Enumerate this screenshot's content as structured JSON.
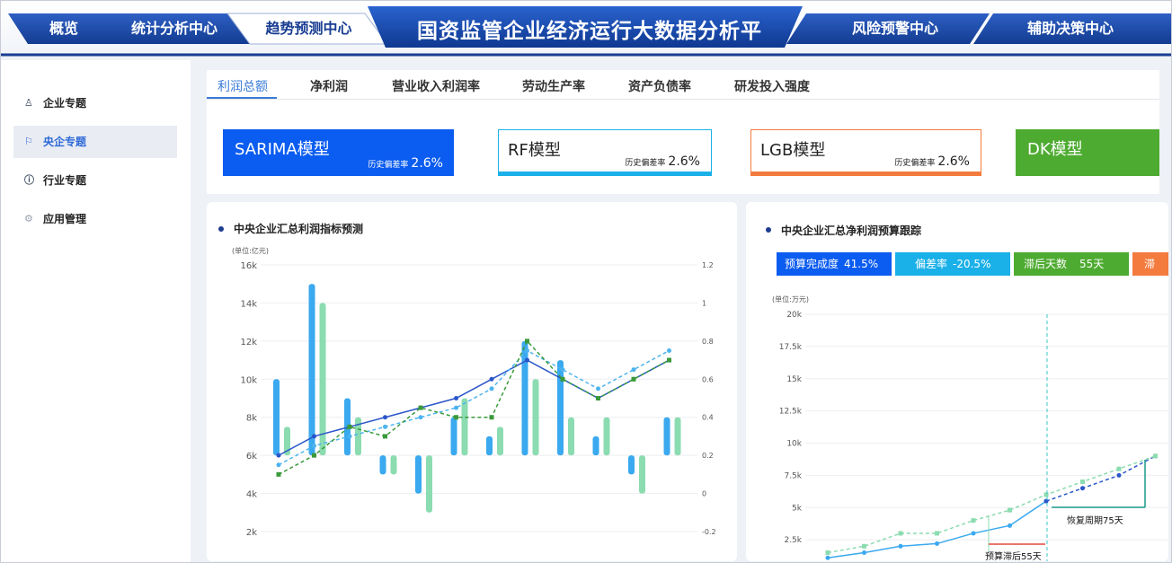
{
  "nav": {
    "items": [
      {
        "label": "概览",
        "active": false
      },
      {
        "label": "统计分析中心",
        "active": false
      },
      {
        "label": "趋势预测中心",
        "active": true
      },
      {
        "label": "风险预警中心",
        "active": false
      },
      {
        "label": "辅助决策中心",
        "active": false
      }
    ],
    "title": "国资监管企业经济运行大数据分析平"
  },
  "sidebar": {
    "items": [
      {
        "label": "企业专题",
        "icon": "building-icon",
        "active": false
      },
      {
        "label": "央企专题",
        "icon": "flag-icon",
        "active": true
      },
      {
        "label": "行业专题",
        "icon": "info-icon",
        "active": false
      },
      {
        "label": "应用管理",
        "icon": "gear-icon",
        "active": false
      }
    ]
  },
  "tabs": [
    "利润总额",
    "净利润",
    "营业收入利润率",
    "劳动生产率",
    "资产负债率",
    "研发投入强度"
  ],
  "models": [
    {
      "name": "SARIMA模型",
      "dev_label": "历史偏差率",
      "dev_value": "2.6%",
      "color": "#0b5cf0"
    },
    {
      "name": "RF模型",
      "dev_label": "历史偏差率",
      "dev_value": "2.6%",
      "color": "#1ab0e8"
    },
    {
      "name": "LGB模型",
      "dev_label": "历史偏差率",
      "dev_value": "2.6%",
      "color": "#f47b3e"
    },
    {
      "name": "DK模型",
      "color": "#4eab31"
    }
  ],
  "left_panel": {
    "title": "中央企业汇总利润指标预测",
    "unit": "(单位:亿元)"
  },
  "right_panel": {
    "title": "中央企业汇总净利润预算跟踪",
    "unit": "(单位:万元)",
    "stats": [
      {
        "label": "预算完成度",
        "value": "41.5%",
        "color": "#0b5cf0"
      },
      {
        "label": "偏差率",
        "value": "-20.5%",
        "color": "#1ab0e8"
      },
      {
        "label": "滞后天数",
        "value": "55天",
        "color": "#4eab31"
      },
      {
        "label": "滞",
        "value": "",
        "color": "#f47b3e"
      }
    ],
    "annotations": {
      "recovery": "恢复周期75天",
      "lag": "预算滞后55天"
    }
  },
  "chart_data": [
    {
      "type": "bar",
      "title": "中央企业汇总利润指标预测",
      "ylabel": "(单位:亿元)",
      "ylim": [
        2000,
        16000
      ],
      "yticks_left": [
        "2k",
        "4k",
        "6k",
        "8k",
        "10k",
        "12k",
        "14k",
        "16k"
      ],
      "y2lim": [
        -0.2,
        1.2
      ],
      "yticks_right": [
        "-0.2",
        "0",
        "0.2",
        "0.4",
        "0.6",
        "0.8",
        "1",
        "1.2"
      ],
      "bar_baseline": 6000,
      "series": [
        {
          "type": "bar",
          "color": "#3aa9ef",
          "values": [
            10000,
            15000,
            9000,
            5000,
            4000,
            8000,
            7000,
            12000,
            11000,
            7000,
            5000,
            8000
          ]
        },
        {
          "type": "bar",
          "color": "#8bdcb0",
          "values": [
            7500,
            14000,
            8000,
            5000,
            3000,
            9000,
            7500,
            10000,
            8000,
            8000,
            4000,
            8000
          ]
        },
        {
          "type": "line",
          "style": "solid",
          "color": "#2a56c9",
          "values": [
            6000,
            7000,
            7500,
            8000,
            8500,
            9000,
            10000,
            11000,
            10000,
            9000,
            10000,
            11000
          ]
        },
        {
          "type": "line",
          "style": "dashed",
          "color": "#4cb3ef",
          "values": [
            5500,
            6500,
            7000,
            7500,
            8000,
            8500,
            9500,
            11500,
            10500,
            9500,
            10500,
            11500
          ]
        },
        {
          "type": "line",
          "style": "dashed",
          "color": "#3a9a3a",
          "values": [
            5000,
            6000,
            7500,
            7000,
            8500,
            8000,
            8000,
            12000,
            10000,
            9000,
            10000,
            11000
          ]
        }
      ]
    },
    {
      "type": "line",
      "title": "中央企业汇总净利润预算跟踪",
      "ylabel": "(单位:万元)",
      "ylim": [
        0,
        20000
      ],
      "yticks": [
        "2.5k",
        "5k",
        "7.5k",
        "10k",
        "12.5k",
        "15k",
        "17.5k",
        "20k"
      ],
      "series": [
        {
          "style": "solid",
          "color": "#3aa9ef",
          "values": [
            1100,
            1500,
            2000,
            2200,
            3000,
            3600,
            5500
          ]
        },
        {
          "style": "dashed",
          "color": "#2a56c9",
          "values": [
            5500,
            6500,
            7500,
            9000
          ]
        },
        {
          "style": "dashed",
          "color": "#8bdcb0",
          "values": [
            1500,
            2000,
            3000,
            3000,
            4000,
            4800,
            6000,
            7000,
            8000,
            9000
          ]
        }
      ]
    }
  ]
}
